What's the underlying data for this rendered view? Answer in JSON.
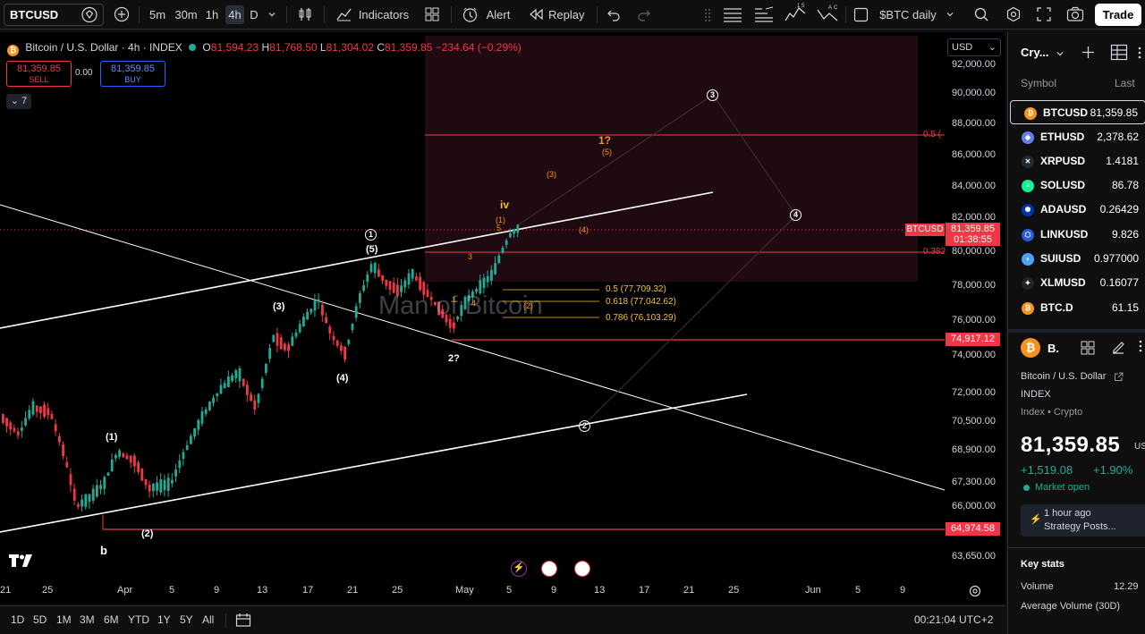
{
  "toolbar": {
    "symbol": "BTCUSD",
    "intervals": [
      "5m",
      "30m",
      "1h",
      "4h",
      "D"
    ],
    "active_interval": "4h",
    "indicators_label": "Indicators",
    "alert_label": "Alert",
    "replay_label": "Replay",
    "layout_name": "$BTC daily",
    "trade_label": "Trade"
  },
  "legend": {
    "title": "Bitcoin / U.S. Dollar · 4h · INDEX",
    "o_label": "O",
    "open": "81,594.23",
    "h_label": "H",
    "high": "81,768.50",
    "l_label": "L",
    "low": "81,304.02",
    "c_label": "C",
    "close": "81,359.85",
    "change": "−234.64 (−0.29%)",
    "sell_price": "81,359.85",
    "sell_label": "SELL",
    "spread": "0.00",
    "buy_price": "81,359.85",
    "buy_label": "BUY",
    "indicators_count": "7",
    "watermark": "Man of Bitcoin",
    "currency": "USD"
  },
  "chart_data": {
    "type": "candlestick",
    "title": "Bitcoin / U.S. Dollar · 4h · INDEX",
    "y_ticks": [
      "92,000.00",
      "90,000.00",
      "88,000.00",
      "86,000.00",
      "84,000.00",
      "82,000.00",
      "80,000.00",
      "78,000.00",
      "76,000.00",
      "74,000.00",
      "72,000.00",
      "70,500.00",
      "68,900.00",
      "67,300.00",
      "66,000.00",
      "63,650.00"
    ],
    "x_ticks": [
      "21",
      "25",
      "Apr",
      "5",
      "9",
      "13",
      "17",
      "21",
      "25",
      "May",
      "5",
      "9",
      "13",
      "17",
      "21",
      "25",
      "Jun",
      "5",
      "9"
    ],
    "last_price": "81,359.85",
    "last_price_symbol": "BTCUSD",
    "countdown": "01:38:55",
    "horizontal_levels": [
      "74,917.12",
      "64,974.58"
    ],
    "fib_levels": [
      "0.5 (77,709.32)",
      "0.618 (77,042.62)",
      "0.786 (76,103.29)"
    ],
    "fib_right_labels": [
      "0.5 (",
      "0.382"
    ],
    "wave_labels": [
      "(1)",
      "(2)",
      "(3)",
      "(4)",
      "(5)",
      "b",
      "1",
      "2?",
      "3",
      "4",
      "5",
      "(1)",
      "(2)",
      "(3)",
      "(4)",
      "(5)",
      "iv",
      "1?"
    ],
    "circled_labels": [
      "1",
      "2",
      "3",
      "4"
    ]
  },
  "bottombar": {
    "ranges": [
      "1D",
      "5D",
      "1M",
      "3M",
      "6M",
      "YTD",
      "1Y",
      "5Y",
      "All"
    ],
    "clock": "00:21:04 UTC+2"
  },
  "watchlist": {
    "title": "Cry...",
    "col_symbol": "Symbol",
    "col_last": "Last",
    "rows": [
      {
        "symbol": "BTCUSD",
        "last": "81,359.85",
        "color": "#f7931a",
        "glyph": "₿"
      },
      {
        "symbol": "ETHUSD",
        "last": "2,378.62",
        "color": "#627eea",
        "glyph": "◆"
      },
      {
        "symbol": "XRPUSD",
        "last": "1.4181",
        "color": "#23292f",
        "glyph": "✕"
      },
      {
        "symbol": "SOLUSD",
        "last": "86.78",
        "color": "#14f195",
        "glyph": "≡"
      },
      {
        "symbol": "ADAUSD",
        "last": "0.26429",
        "color": "#0033ad",
        "glyph": "✺"
      },
      {
        "symbol": "LINKUSD",
        "last": "9.826",
        "color": "#2a5ada",
        "glyph": "⬡"
      },
      {
        "symbol": "SUIUSD",
        "last": "0.977000",
        "color": "#4da2ff",
        "glyph": "◗"
      },
      {
        "symbol": "XLMUSD",
        "last": "0.16077",
        "color": "#222",
        "glyph": "✦"
      },
      {
        "symbol": "BTC.D",
        "last": "61.15",
        "color": "#f7931a",
        "glyph": "₿"
      }
    ]
  },
  "details": {
    "short_name": "B.",
    "name": "Bitcoin / U.S. Dollar",
    "exchange": "INDEX",
    "category": "Index • Crypto",
    "price": "81,359.85",
    "currency": "USI",
    "change": "+1,519.08",
    "change_pct": "+1.90%",
    "market_status": "Market open",
    "news_time": "1 hour ago",
    "news_text": "Strategy Posts...",
    "key_stats": "Key stats",
    "volume_label": "Volume",
    "volume_value": "12.29",
    "avg_volume_label": "Average Volume (30D)"
  }
}
